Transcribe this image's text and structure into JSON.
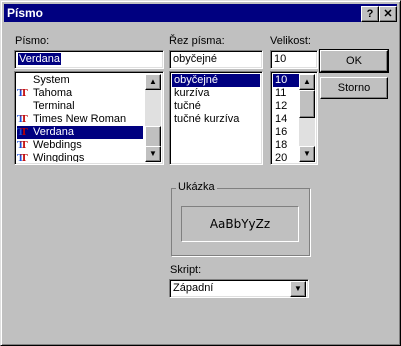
{
  "window": {
    "title": "Písmo",
    "help_glyph": "?",
    "close_glyph": "✕"
  },
  "font": {
    "label": "Písmo:",
    "value": "Verdana",
    "items": [
      {
        "name": "System",
        "tt": false
      },
      {
        "name": "Tahoma",
        "tt": true
      },
      {
        "name": "Terminal",
        "tt": false
      },
      {
        "name": "Times New Roman",
        "tt": true
      },
      {
        "name": "Verdana",
        "tt": true,
        "selected": true
      },
      {
        "name": "Webdings",
        "tt": true
      },
      {
        "name": "Wingdings",
        "tt": true
      }
    ]
  },
  "style": {
    "label": "Řez písma:",
    "value": "obyčejné",
    "items": [
      "obyčejné",
      "kurzíva",
      "tučné",
      "tučné kurzíva"
    ]
  },
  "size": {
    "label": "Velikost:",
    "value": "10",
    "items": [
      "10",
      "11",
      "12",
      "14",
      "16",
      "18",
      "20"
    ]
  },
  "buttons": {
    "ok": "OK",
    "cancel": "Storno"
  },
  "sample": {
    "label": "Ukázka",
    "text": "AaBbYyZz"
  },
  "script": {
    "label": "Skript:",
    "value": "Západní"
  },
  "icons": {
    "truetype": "truetype-icon",
    "arrow_up": "▲",
    "arrow_down": "▼"
  }
}
